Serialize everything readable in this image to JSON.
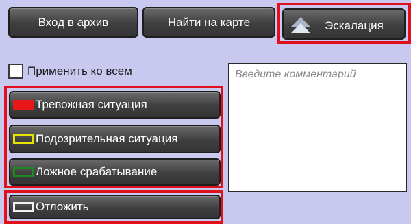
{
  "top_buttons": {
    "archive_label": "Вход в архив",
    "map_label": "Найти на карте",
    "escalation_label": "Эскалация"
  },
  "apply_all": {
    "label": "Применить ко всем",
    "checked": false
  },
  "comment": {
    "placeholder": "Введите комментарий"
  },
  "status_buttons": [
    {
      "label": "Тревожная ситуация",
      "color": "#e81818",
      "icon": "filled-red-swatch-icon"
    },
    {
      "label": "Подозрительная ситуация",
      "color": "#e4e400",
      "icon": "yellow-outline-swatch-icon"
    },
    {
      "label": "Ложное срабатывание",
      "color": "#1c8a1c",
      "icon": "green-outline-swatch-icon"
    }
  ],
  "postpone": {
    "label": "Отложить",
    "color": "#f2f2f2",
    "icon": "white-outline-swatch-icon"
  },
  "colors": {
    "background": "#c9c9ef",
    "highlight": "#e0101a",
    "button": "#3f3f3f"
  }
}
